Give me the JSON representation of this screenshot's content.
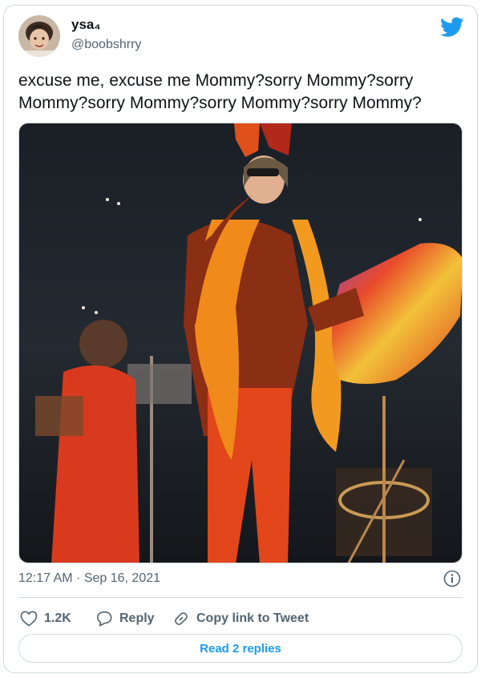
{
  "user": {
    "display_name": "ysa₄",
    "handle": "@boobshrry"
  },
  "tweet": {
    "text": "excuse me, excuse me Mommy?sorry Mommy?sorry Mommy?sorry Mommy?sorry Mommy?sorry Mommy?",
    "timestamp": "12:17 AM · Sep 16, 2021"
  },
  "actions": {
    "like_count": "1.2K",
    "reply_label": "Reply",
    "copy_label": "Copy link to Tweet"
  },
  "read_replies_label": "Read 2 replies",
  "icons": {
    "logo": "twitter-bird-icon",
    "info": "info-icon",
    "like": "heart-icon",
    "reply": "reply-bubble-icon",
    "copy": "link-icon"
  },
  "colors": {
    "accent": "#1d9bf0",
    "text": "#0f1419",
    "secondary": "#536471",
    "border": "#cfd9de"
  }
}
